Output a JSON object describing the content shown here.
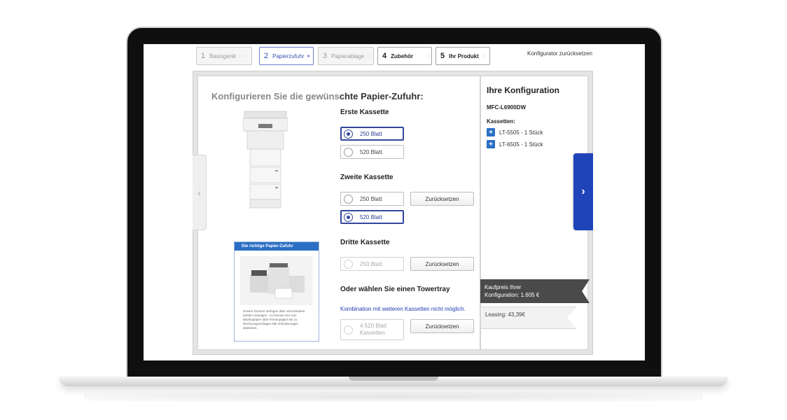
{
  "steps": [
    {
      "num": "1",
      "label": "Basisgerät"
    },
    {
      "num": "2",
      "label": "Papierzufuhr"
    },
    {
      "num": "3",
      "label": "Papierablage"
    },
    {
      "num": "4",
      "label": "Zubehör"
    },
    {
      "num": "5",
      "label": "Ihr Produkt"
    }
  ],
  "reset_link": "Konfigurator zurücksetzen",
  "main": {
    "heading_light": "Konfigurieren Sie die gewüns",
    "heading_dark": "chte Papier-Zufuhr:"
  },
  "brochure": {
    "title": "Die richtige Papier-Zufuhr",
    "text": "Unsere Drucker verfügen über verschiedene Zufuhr-Lösungen - so können Sie vom Blankopapier über Firmenpapier bis zu Rechnungsvorlagen alle Anforderungen abdecken."
  },
  "sections": {
    "erste": "Erste Kassette",
    "zweite": "Zweite Kassette",
    "dritte": "Dritte Kassette",
    "tower": "Oder wählen Sie einen Towertray"
  },
  "options": {
    "erste_250": "250 Blatt",
    "erste_520": "520 Blatt",
    "zweite_250": "250 Blatt",
    "zweite_520": "520 Blatt",
    "dritte_250": "250 Blatt",
    "tower_line1": "4 520 Blatt",
    "tower_line2": "Kassetten"
  },
  "reset_button": "Zurücksetzen",
  "tower_note": "Kombination mit weiteren Kassetten nicht möglich.",
  "config": {
    "title": "Ihre Konfiguration",
    "model": "MFC-L6900DW",
    "kassetten_label": "Kassetten:",
    "items": [
      "LT-5505 - 1 Stück",
      "LT-6505 - 1 Stück"
    ],
    "price_line1": "Kaufpreis Ihrer",
    "price_line2": "Konfiguration: 1.605 €",
    "leasing": "Leasing: 43,39€"
  },
  "icons": {
    "prev": "chevron-left-icon",
    "next": "chevron-right-icon",
    "add": "plus-icon"
  },
  "colors": {
    "accent": "#1f43b8",
    "selected": "#34479b",
    "link": "#1f3fb0",
    "price_bg": "#4a4a4a"
  }
}
